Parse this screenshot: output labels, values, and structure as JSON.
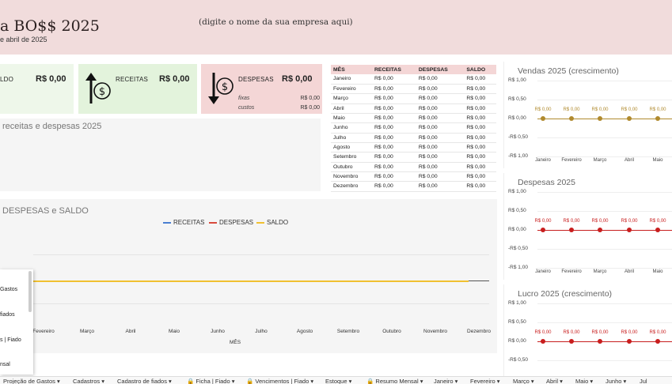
{
  "header": {
    "title": "a BO$$ 2025",
    "subtitle": "e abril de 2025",
    "company_placeholder": "(digite o nome da sua empresa aqui)"
  },
  "kpis": {
    "saldo": {
      "label": "LDO",
      "value": "R$ 0,00"
    },
    "receitas": {
      "label": "RECEITAS",
      "value": "R$ 0,00"
    },
    "despesas": {
      "label": "DESPESAS",
      "value": "R$ 0,00",
      "sub": [
        {
          "label": "fixas",
          "value": "R$ 0,00"
        },
        {
          "label": "custos",
          "value": "R$ 0,00"
        }
      ]
    }
  },
  "comparison_panel": {
    "title": "receitas e despesas 2025"
  },
  "monthly_table": {
    "headers": [
      "MÊS",
      "RECEITAS",
      "DESPESAS",
      "SALDO"
    ],
    "rows": [
      [
        "Janeiro",
        "R$ 0,00",
        "R$ 0,00",
        "R$ 0,00"
      ],
      [
        "Fevereiro",
        "R$ 0,00",
        "R$ 0,00",
        "R$ 0,00"
      ],
      [
        "Março",
        "R$ 0,00",
        "R$ 0,00",
        "R$ 0,00"
      ],
      [
        "Abril",
        "R$ 0,00",
        "R$ 0,00",
        "R$ 0,00"
      ],
      [
        "Maio",
        "R$ 0,00",
        "R$ 0,00",
        "R$ 0,00"
      ],
      [
        "Junho",
        "R$ 0,00",
        "R$ 0,00",
        "R$ 0,00"
      ],
      [
        "Julho",
        "R$ 0,00",
        "R$ 0,00",
        "R$ 0,00"
      ],
      [
        "Agosto",
        "R$ 0,00",
        "R$ 0,00",
        "R$ 0,00"
      ],
      [
        "Setembro",
        "R$ 0,00",
        "R$ 0,00",
        "R$ 0,00"
      ],
      [
        "Outubro",
        "R$ 0,00",
        "R$ 0,00",
        "R$ 0,00"
      ],
      [
        "Novembro",
        "R$ 0,00",
        "R$ 0,00",
        "R$ 0,00"
      ],
      [
        "Dezembro",
        "R$ 0,00",
        "R$ 0,00",
        "R$ 0,00"
      ]
    ]
  },
  "main_chart": {
    "title": "DESPESAS e SALDO",
    "xlabel": "MÊS",
    "legend": [
      {
        "name": "RECEITAS",
        "color": "#4a7fd1"
      },
      {
        "name": "DESPESAS",
        "color": "#d84a3c"
      },
      {
        "name": "SALDO",
        "color": "#f0c030"
      }
    ],
    "months": [
      "Fevereiro",
      "Março",
      "Abril",
      "Maio",
      "Junho",
      "Julho",
      "Agosto",
      "Setembro",
      "Outubro",
      "Novembro",
      "Dezembro"
    ]
  },
  "mini_charts": [
    {
      "title": "Vendas 2025 (crescimento)",
      "color": "#b08a2e",
      "ticks": [
        "R$ 1,00",
        "R$ 0,50",
        "R$ 0,00",
        "-R$ 0,50",
        "-R$ 1,00"
      ],
      "months": [
        "Janeiro",
        "Fevereiro",
        "Março",
        "Abril",
        "Maio"
      ],
      "value_label": "R$ 0,00"
    },
    {
      "title": "Despesas 2025",
      "color": "#c81e1e",
      "ticks": [
        "R$ 1,00",
        "R$ 0,50",
        "R$ 0,00",
        "-R$ 0,50",
        "-R$ 1,00"
      ],
      "months": [
        "Janeiro",
        "Fevereiro",
        "Março",
        "Abril",
        "Maio"
      ],
      "value_label": "R$ 0,00"
    },
    {
      "title": "Lucro 2025 (crescimento)",
      "color": "#c81e1e",
      "ticks": [
        "R$ 1,00",
        "R$ 0,50",
        "R$ 0,00",
        "-R$ 0,50"
      ],
      "months": [],
      "value_label": "R$ 0,00"
    }
  ],
  "chart_data": [
    {
      "type": "line",
      "title": "DESPESAS e SALDO",
      "xlabel": "MÊS",
      "categories": [
        "Fevereiro",
        "Março",
        "Abril",
        "Maio",
        "Junho",
        "Julho",
        "Agosto",
        "Setembro",
        "Outubro",
        "Novembro",
        "Dezembro"
      ],
      "series": [
        {
          "name": "RECEITAS",
          "values": [
            0,
            0,
            0,
            0,
            0,
            0,
            0,
            0,
            0,
            0,
            0
          ]
        },
        {
          "name": "DESPESAS",
          "values": [
            0,
            0,
            0,
            0,
            0,
            0,
            0,
            0,
            0,
            0,
            0
          ]
        },
        {
          "name": "SALDO",
          "values": [
            0,
            0,
            0,
            0,
            0,
            0,
            0,
            0,
            0,
            0,
            0
          ]
        }
      ],
      "legend": "top"
    },
    {
      "type": "line",
      "title": "Vendas 2025 (crescimento)",
      "categories": [
        "Janeiro",
        "Fevereiro",
        "Março",
        "Abril",
        "Maio"
      ],
      "values": [
        0,
        0,
        0,
        0,
        0
      ],
      "ylim": [
        -1,
        1
      ]
    },
    {
      "type": "line",
      "title": "Despesas 2025",
      "categories": [
        "Janeiro",
        "Fevereiro",
        "Março",
        "Abril",
        "Maio"
      ],
      "values": [
        0,
        0,
        0,
        0,
        0
      ],
      "ylim": [
        -1,
        1
      ]
    },
    {
      "type": "line",
      "title": "Lucro 2025 (crescimento)",
      "values": [
        0,
        0,
        0,
        0,
        0
      ],
      "ylim": [
        -0.5,
        1
      ]
    }
  ],
  "dropdown": {
    "items": [
      "Gastos",
      "fiados",
      "s | Fiado",
      "nsal"
    ]
  },
  "tabs": [
    "Projeção de Gastos ▾",
    "Cadastros ▾",
    "Cadastro de fiados ▾",
    "🔒 Ficha | Fiado ▾",
    "🔒 Vencimentos | Fiado ▾",
    "Estoque ▾",
    "🔒 Resumo Mensal ▾",
    "Janeiro ▾",
    "Fevereiro ▾",
    "Março ▾",
    "Abril ▾",
    "Maio ▾",
    "Junho ▾",
    "Jul"
  ]
}
